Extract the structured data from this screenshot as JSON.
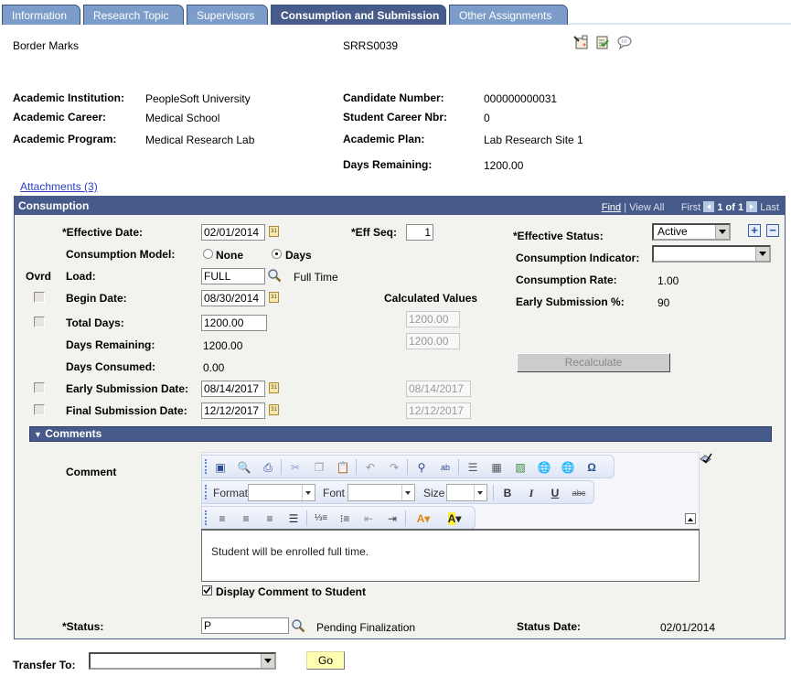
{
  "tabs": [
    {
      "label": "Information",
      "active": false
    },
    {
      "label": "Research Topic",
      "active": false
    },
    {
      "label": "Supervisors",
      "active": false
    },
    {
      "label": "Consumption and Submission",
      "active": true
    },
    {
      "label": "Other Assignments",
      "active": false
    }
  ],
  "header": {
    "name": "Border Marks",
    "id": "SRRS0039",
    "icons": [
      "notepad-phone-icon",
      "checklist-icon",
      "comment-bubble-icon"
    ]
  },
  "summary": {
    "left": [
      {
        "label": "Academic Institution:",
        "value": "PeopleSoft University"
      },
      {
        "label": "Academic Career:",
        "value": "Medical School"
      },
      {
        "label": "Academic Program:",
        "value": "Medical Research Lab"
      }
    ],
    "right": [
      {
        "label": "Candidate Number:",
        "value": "000000000031"
      },
      {
        "label": "Student Career Nbr:",
        "value": "0"
      },
      {
        "label": "Academic Plan:",
        "value": "Lab Research Site 1"
      },
      {
        "label": "Days Remaining:",
        "value": "1200.00"
      }
    ]
  },
  "attachments_link": "Attachments (3)",
  "consumption": {
    "title": "Consumption",
    "nav": {
      "find": "Find",
      "sep": "|",
      "view_all": "View All",
      "first": "First",
      "count": "1 of 1",
      "last": "Last"
    },
    "effective_date": {
      "label": "*Effective Date:",
      "value": "02/01/2014"
    },
    "eff_seq": {
      "label": "*Eff Seq:",
      "value": "1"
    },
    "effective_status": {
      "label": "*Effective Status:",
      "value": "Active"
    },
    "consumption_model": {
      "label": "Consumption Model:",
      "options": [
        "None",
        "Days"
      ],
      "selected": "Days"
    },
    "consumption_indicator": {
      "label": "Consumption Indicator:",
      "value": ""
    },
    "ovrd_header": "Ovrd",
    "load": {
      "label": "Load:",
      "value": "FULL",
      "description": "Full Time"
    },
    "consumption_rate": {
      "label": "Consumption Rate:",
      "value": "1.00"
    },
    "early_submission_pct": {
      "label": "Early Submission %:",
      "value": "90"
    },
    "begin_date": {
      "label": "Begin Date:",
      "value": "08/30/2014",
      "ovrd": false
    },
    "calculated_values_label": "Calculated Values",
    "total_days": {
      "label": "Total Days:",
      "value": "1200.00",
      "calculated": "1200.00",
      "ovrd": false
    },
    "days_remaining": {
      "label": "Days Remaining:",
      "value": "1200.00",
      "calculated": "1200.00"
    },
    "days_consumed": {
      "label": "Days Consumed:",
      "value": "0.00"
    },
    "early_submission_date": {
      "label": "Early Submission Date:",
      "value": "08/14/2017",
      "calculated": "08/14/2017",
      "ovrd": false
    },
    "final_submission_date": {
      "label": "Final Submission Date:",
      "value": "12/12/2017",
      "calculated": "12/12/2017",
      "ovrd": false
    },
    "recalculate_label": "Recalculate",
    "comments": {
      "title": "Comments",
      "comment_label": "Comment",
      "toolbar": {
        "format_label": "Format",
        "font_label": "Font",
        "size_label": "Size",
        "format_value": "",
        "font_value": "",
        "size_value": ""
      },
      "text": "Student will be enrolled full time.",
      "display_to_student": {
        "label": "Display Comment to Student",
        "checked": true
      }
    },
    "status": {
      "label": "*Status:",
      "value": "P",
      "description": "Pending Finalization"
    },
    "status_date": {
      "label": "Status Date:",
      "value": "02/01/2014"
    }
  },
  "footer": {
    "transfer_label": "Transfer To:",
    "transfer_value": "",
    "go_label": "Go"
  }
}
